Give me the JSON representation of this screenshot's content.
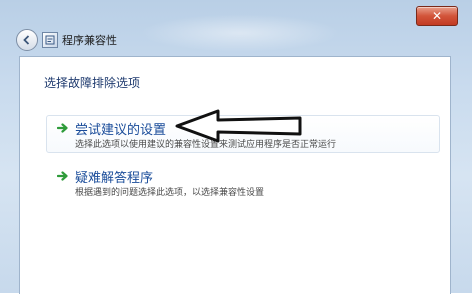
{
  "window": {
    "title": "程序兼容性",
    "close_glyph": "✕",
    "back_glyph": "←",
    "icon": "compat-app-icon"
  },
  "content": {
    "heading": "选择故障排除选项",
    "options": [
      {
        "title": "尝试建议的设置",
        "description": "选择此选项以使用建议的兼容性设置来测试应用程序是否正常运行",
        "icon": "green-arrow-icon"
      },
      {
        "title": "疑难解答程序",
        "description": "根据遇到的问题选择此选项，以选择兼容性设置",
        "icon": "green-arrow-icon"
      }
    ]
  },
  "colors": {
    "link": "#1a4c9a",
    "heading": "#1e3a6e",
    "arrow_green": "#2e9b3a",
    "close_red": "#c23b22"
  }
}
